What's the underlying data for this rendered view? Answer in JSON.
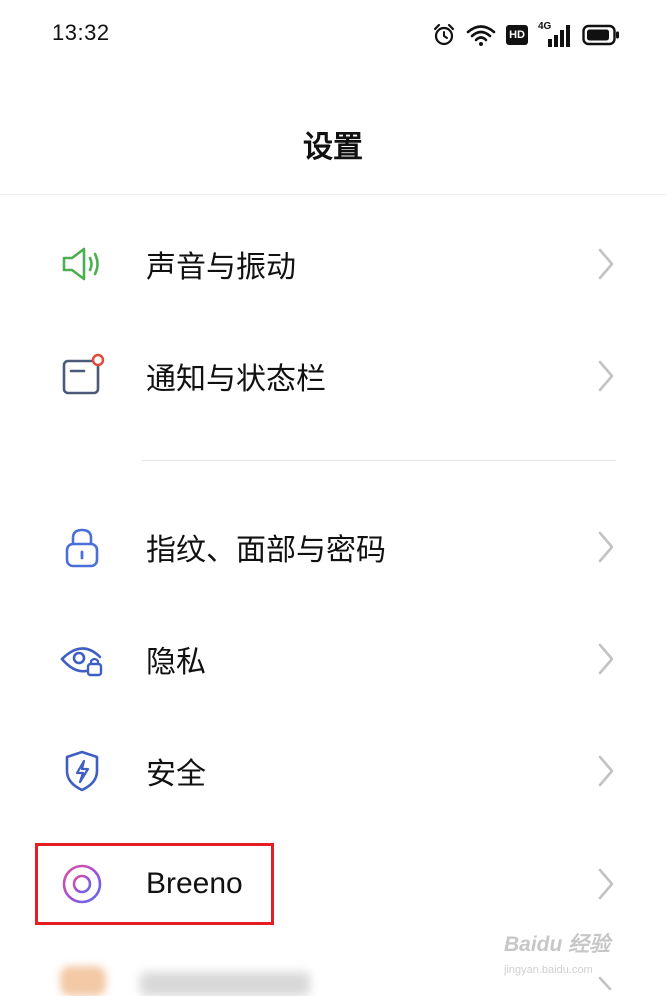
{
  "status_bar": {
    "time": "13:32",
    "icons": [
      "alarm-icon",
      "wifi-icon",
      "hd-icon",
      "signal-icon",
      "battery-icon"
    ],
    "hd_text": "HD",
    "network_text": "4G"
  },
  "header": {
    "title": "设置"
  },
  "settings": {
    "group1": [
      {
        "label": "声音与振动",
        "icon": "speaker-icon",
        "color": "#4caf50"
      },
      {
        "label": "通知与状态栏",
        "icon": "notification-icon",
        "color": "#4a5a78"
      }
    ],
    "group2": [
      {
        "label": "指纹、面部与密码",
        "icon": "lock-icon",
        "color": "#4a6fd6"
      },
      {
        "label": "隐私",
        "icon": "privacy-eye-icon",
        "color": "#3f5fc4"
      },
      {
        "label": "安全",
        "icon": "shield-icon",
        "color": "#3f5fc4"
      },
      {
        "label": "Breeno",
        "icon": "breeno-icon",
        "color": "#a44cd6"
      }
    ]
  },
  "annotation": {
    "highlight_color": "#e31e24"
  },
  "watermark": {
    "brand": "Baidu 经验",
    "sub": "jingyan.baidu.com"
  }
}
